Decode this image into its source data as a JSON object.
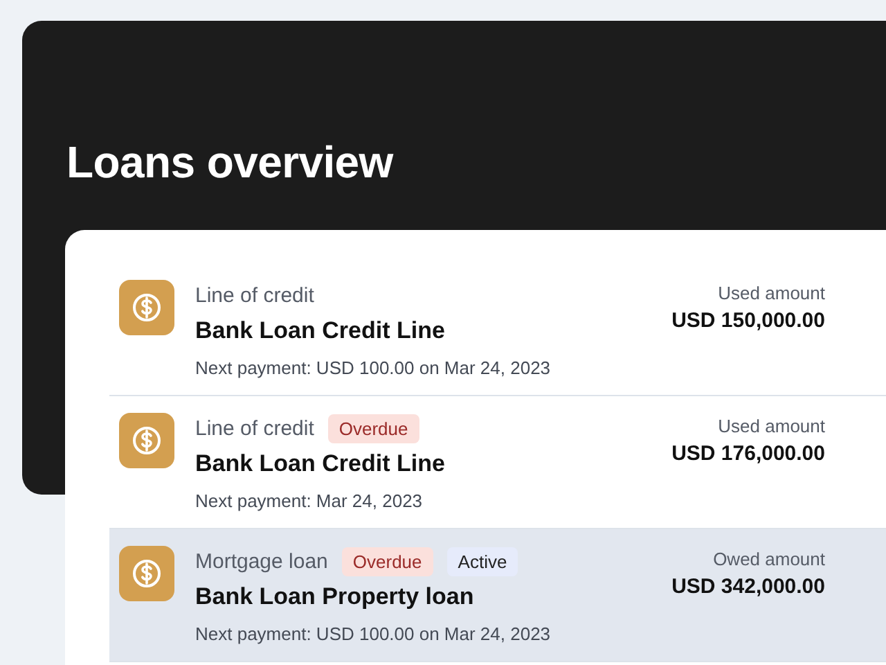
{
  "header": {
    "title": "Loans overview"
  },
  "loans": [
    {
      "type": "Line of credit",
      "name": "Bank Loan Credit Line",
      "next_payment": "Next payment: USD 100.00 on Mar 24, 2023",
      "amount_label": "Used amount",
      "amount": "USD 150,000.00",
      "selected": false
    },
    {
      "type": "Line of credit",
      "badges": [
        {
          "label": "Overdue",
          "kind": "danger"
        }
      ],
      "name": "Bank Loan Credit Line",
      "next_payment": "Next payment: Mar 24, 2023",
      "amount_label": "Used amount",
      "amount": "USD 176,000.00",
      "selected": false
    },
    {
      "type": "Mortgage loan",
      "badges": [
        {
          "label": "Overdue",
          "kind": "danger"
        },
        {
          "label": "Active",
          "kind": "info"
        }
      ],
      "name": "Bank Loan Property loan",
      "next_payment": "Next payment: USD 100.00 on Mar 24, 2023",
      "amount_label": "Owed amount",
      "amount": "USD 342,000.00",
      "selected": true
    }
  ]
}
